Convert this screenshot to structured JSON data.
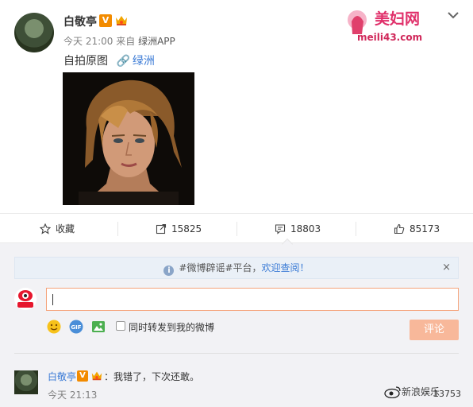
{
  "post": {
    "username": "白敬亭",
    "verified_badge": "V",
    "time": "今天 21:00",
    "source_prefix": "来自",
    "source": "绿洲APP",
    "text": "自拍原图",
    "link_text": "绿洲"
  },
  "watermark": {
    "text": "美妇网",
    "url": "meili43.com"
  },
  "actions": {
    "favorite": {
      "label": "收藏",
      "icon": "star-icon"
    },
    "repost": {
      "label": "15825",
      "icon": "repost-icon"
    },
    "comment": {
      "label": "18803",
      "icon": "comment-icon"
    },
    "like": {
      "label": "85173",
      "icon": "thumb-up-icon"
    }
  },
  "notice": {
    "text": "#微博辟谣#平台，",
    "link": "欢迎查阅！",
    "close": "×"
  },
  "composer": {
    "input_value": "",
    "repost_label": "同时转发到我的微博",
    "submit_label": "评论"
  },
  "comment": {
    "username": "白敬亭",
    "verified_badge": "V",
    "text": "：我错了，下次还敢。",
    "time": "今天 21:13",
    "brand": "新浪娱乐",
    "count": "13753"
  },
  "colors": {
    "accent": "#eb7350",
    "link": "#3b7bd6",
    "verified": "#f28b00",
    "submit_disabled": "#f8b89a"
  }
}
